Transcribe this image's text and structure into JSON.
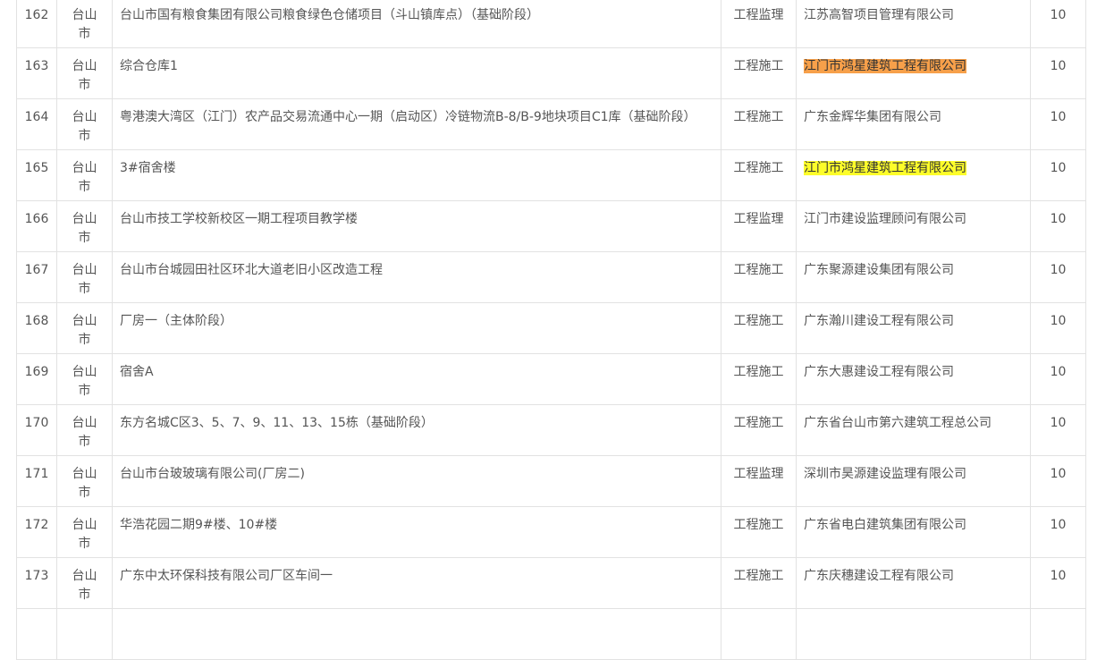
{
  "rows": [
    {
      "no": "162",
      "city": "台山市",
      "name": "台山市国有粮食集团有限公司粮食绿色仓储项目（斗山镇库点）（基础阶段）",
      "type": "工程监理",
      "company": "江苏高智项目管理有限公司",
      "score": "10",
      "highlight": ""
    },
    {
      "no": "163",
      "city": "台山市",
      "name": "综合仓库1",
      "type": "工程施工",
      "company": "江门市鸿星建筑工程有限公司",
      "score": "10",
      "highlight": "orange"
    },
    {
      "no": "164",
      "city": "台山市",
      "name": "粤港澳大湾区（江门）农产品交易流通中心一期（启动区）冷链物流B-8/B-9地块项目C1库（基础阶段）",
      "type": "工程施工",
      "company": "广东金辉华集团有限公司",
      "score": "10",
      "highlight": ""
    },
    {
      "no": "165",
      "city": "台山市",
      "name": "3#宿舍楼",
      "type": "工程施工",
      "company": "江门市鸿星建筑工程有限公司",
      "score": "10",
      "highlight": "yellow"
    },
    {
      "no": "166",
      "city": "台山市",
      "name": "台山市技工学校新校区一期工程项目教学楼",
      "type": "工程监理",
      "company": "江门市建设监理顾问有限公司",
      "score": "10",
      "highlight": ""
    },
    {
      "no": "167",
      "city": "台山市",
      "name": "台山市台城园田社区环北大道老旧小区改造工程",
      "type": "工程施工",
      "company": "广东聚源建设集团有限公司",
      "score": "10",
      "highlight": ""
    },
    {
      "no": "168",
      "city": "台山市",
      "name": "厂房一（主体阶段）",
      "type": "工程施工",
      "company": "广东瀚川建设工程有限公司",
      "score": "10",
      "highlight": ""
    },
    {
      "no": "169",
      "city": "台山市",
      "name": "宿舍A",
      "type": "工程施工",
      "company": "广东大惠建设工程有限公司",
      "score": "10",
      "highlight": ""
    },
    {
      "no": "170",
      "city": "台山市",
      "name": "东方名城C区3、5、7、9、11、13、15栋（基础阶段）",
      "type": "工程施工",
      "company": "广东省台山市第六建筑工程总公司",
      "score": "10",
      "highlight": ""
    },
    {
      "no": "171",
      "city": "台山市",
      "name": "台山市台玻玻璃有限公司(厂房二)",
      "type": "工程监理",
      "company": "深圳市昊源建设监理有限公司",
      "score": "10",
      "highlight": ""
    },
    {
      "no": "172",
      "city": "台山市",
      "name": "华浩花园二期9#楼、10#楼",
      "type": "工程施工",
      "company": "广东省电白建筑集团有限公司",
      "score": "10",
      "highlight": ""
    },
    {
      "no": "173",
      "city": "台山市",
      "name": "广东中太环保科技有限公司厂区车间一",
      "type": "工程施工",
      "company": "广东庆穗建设工程有限公司",
      "score": "10",
      "highlight": ""
    },
    {
      "no": "",
      "city": "",
      "name": "",
      "type": "",
      "company": "",
      "score": "",
      "highlight": ""
    }
  ]
}
